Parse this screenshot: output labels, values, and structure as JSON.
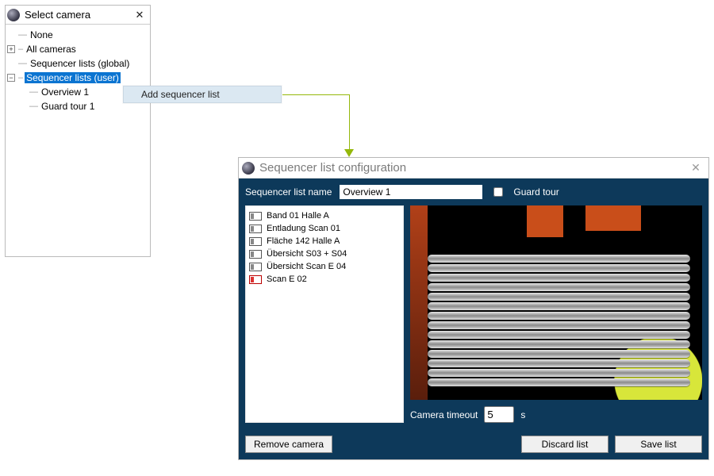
{
  "selectWindow": {
    "title": "Select camera",
    "tree": {
      "none": "None",
      "allCameras": "All cameras",
      "seqGlobal": "Sequencer lists (global)",
      "seqUser": "Sequencer lists (user)",
      "children": {
        "overview1": "Overview 1",
        "guardTour1": "Guard tour 1"
      }
    }
  },
  "contextMenu": {
    "addSequencerList": "Add sequencer list"
  },
  "configWindow": {
    "title": "Sequencer list configuration",
    "nameLabel": "Sequencer list name",
    "nameValue": "Overview 1",
    "guardTourLabel": "Guard tour",
    "guardTourChecked": false,
    "cameras": [
      "Band 01 Halle A",
      "Entladung Scan 01",
      "Fläche 142 Halle A",
      "Übersicht S03 + S04",
      "Übersicht Scan E 04",
      "Scan E 02"
    ],
    "timeoutLabel": "Camera timeout",
    "timeoutValue": "5",
    "timeoutUnit": "s",
    "buttons": {
      "remove": "Remove camera",
      "discard": "Discard list",
      "save": "Save list"
    }
  }
}
